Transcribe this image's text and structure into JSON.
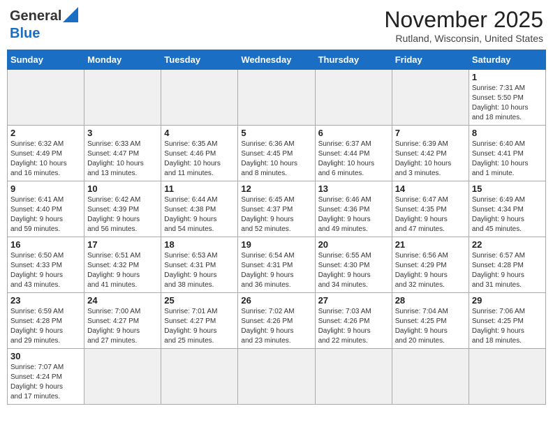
{
  "header": {
    "logo_general": "General",
    "logo_blue": "Blue",
    "month_title": "November 2025",
    "location": "Rutland, Wisconsin, United States"
  },
  "weekdays": [
    "Sunday",
    "Monday",
    "Tuesday",
    "Wednesday",
    "Thursday",
    "Friday",
    "Saturday"
  ],
  "weeks": [
    [
      {
        "day": "",
        "info": ""
      },
      {
        "day": "",
        "info": ""
      },
      {
        "day": "",
        "info": ""
      },
      {
        "day": "",
        "info": ""
      },
      {
        "day": "",
        "info": ""
      },
      {
        "day": "",
        "info": ""
      },
      {
        "day": "1",
        "info": "Sunrise: 7:31 AM\nSunset: 5:50 PM\nDaylight: 10 hours\nand 18 minutes."
      }
    ],
    [
      {
        "day": "2",
        "info": "Sunrise: 6:32 AM\nSunset: 4:49 PM\nDaylight: 10 hours\nand 16 minutes."
      },
      {
        "day": "3",
        "info": "Sunrise: 6:33 AM\nSunset: 4:47 PM\nDaylight: 10 hours\nand 13 minutes."
      },
      {
        "day": "4",
        "info": "Sunrise: 6:35 AM\nSunset: 4:46 PM\nDaylight: 10 hours\nand 11 minutes."
      },
      {
        "day": "5",
        "info": "Sunrise: 6:36 AM\nSunset: 4:45 PM\nDaylight: 10 hours\nand 8 minutes."
      },
      {
        "day": "6",
        "info": "Sunrise: 6:37 AM\nSunset: 4:44 PM\nDaylight: 10 hours\nand 6 minutes."
      },
      {
        "day": "7",
        "info": "Sunrise: 6:39 AM\nSunset: 4:42 PM\nDaylight: 10 hours\nand 3 minutes."
      },
      {
        "day": "8",
        "info": "Sunrise: 6:40 AM\nSunset: 4:41 PM\nDaylight: 10 hours\nand 1 minute."
      }
    ],
    [
      {
        "day": "9",
        "info": "Sunrise: 6:41 AM\nSunset: 4:40 PM\nDaylight: 9 hours\nand 59 minutes."
      },
      {
        "day": "10",
        "info": "Sunrise: 6:42 AM\nSunset: 4:39 PM\nDaylight: 9 hours\nand 56 minutes."
      },
      {
        "day": "11",
        "info": "Sunrise: 6:44 AM\nSunset: 4:38 PM\nDaylight: 9 hours\nand 54 minutes."
      },
      {
        "day": "12",
        "info": "Sunrise: 6:45 AM\nSunset: 4:37 PM\nDaylight: 9 hours\nand 52 minutes."
      },
      {
        "day": "13",
        "info": "Sunrise: 6:46 AM\nSunset: 4:36 PM\nDaylight: 9 hours\nand 49 minutes."
      },
      {
        "day": "14",
        "info": "Sunrise: 6:47 AM\nSunset: 4:35 PM\nDaylight: 9 hours\nand 47 minutes."
      },
      {
        "day": "15",
        "info": "Sunrise: 6:49 AM\nSunset: 4:34 PM\nDaylight: 9 hours\nand 45 minutes."
      }
    ],
    [
      {
        "day": "16",
        "info": "Sunrise: 6:50 AM\nSunset: 4:33 PM\nDaylight: 9 hours\nand 43 minutes."
      },
      {
        "day": "17",
        "info": "Sunrise: 6:51 AM\nSunset: 4:32 PM\nDaylight: 9 hours\nand 41 minutes."
      },
      {
        "day": "18",
        "info": "Sunrise: 6:53 AM\nSunset: 4:31 PM\nDaylight: 9 hours\nand 38 minutes."
      },
      {
        "day": "19",
        "info": "Sunrise: 6:54 AM\nSunset: 4:31 PM\nDaylight: 9 hours\nand 36 minutes."
      },
      {
        "day": "20",
        "info": "Sunrise: 6:55 AM\nSunset: 4:30 PM\nDaylight: 9 hours\nand 34 minutes."
      },
      {
        "day": "21",
        "info": "Sunrise: 6:56 AM\nSunset: 4:29 PM\nDaylight: 9 hours\nand 32 minutes."
      },
      {
        "day": "22",
        "info": "Sunrise: 6:57 AM\nSunset: 4:28 PM\nDaylight: 9 hours\nand 31 minutes."
      }
    ],
    [
      {
        "day": "23",
        "info": "Sunrise: 6:59 AM\nSunset: 4:28 PM\nDaylight: 9 hours\nand 29 minutes."
      },
      {
        "day": "24",
        "info": "Sunrise: 7:00 AM\nSunset: 4:27 PM\nDaylight: 9 hours\nand 27 minutes."
      },
      {
        "day": "25",
        "info": "Sunrise: 7:01 AM\nSunset: 4:27 PM\nDaylight: 9 hours\nand 25 minutes."
      },
      {
        "day": "26",
        "info": "Sunrise: 7:02 AM\nSunset: 4:26 PM\nDaylight: 9 hours\nand 23 minutes."
      },
      {
        "day": "27",
        "info": "Sunrise: 7:03 AM\nSunset: 4:26 PM\nDaylight: 9 hours\nand 22 minutes."
      },
      {
        "day": "28",
        "info": "Sunrise: 7:04 AM\nSunset: 4:25 PM\nDaylight: 9 hours\nand 20 minutes."
      },
      {
        "day": "29",
        "info": "Sunrise: 7:06 AM\nSunset: 4:25 PM\nDaylight: 9 hours\nand 18 minutes."
      }
    ],
    [
      {
        "day": "30",
        "info": "Sunrise: 7:07 AM\nSunset: 4:24 PM\nDaylight: 9 hours\nand 17 minutes."
      },
      {
        "day": "",
        "info": ""
      },
      {
        "day": "",
        "info": ""
      },
      {
        "day": "",
        "info": ""
      },
      {
        "day": "",
        "info": ""
      },
      {
        "day": "",
        "info": ""
      },
      {
        "day": "",
        "info": ""
      }
    ]
  ]
}
